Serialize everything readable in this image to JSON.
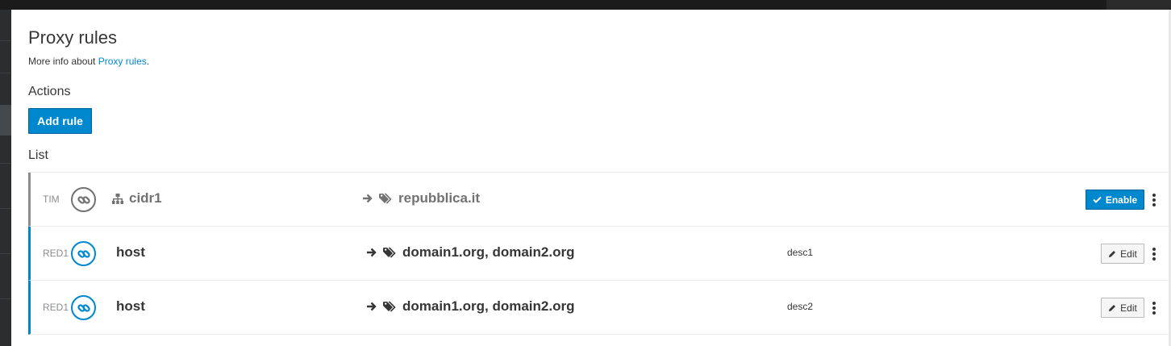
{
  "page": {
    "title": "Proxy rules",
    "more_info_prefix": "More info about",
    "more_info_link": "Proxy rules",
    "more_info_suffix": ".",
    "actions_heading": "Actions",
    "add_rule_label": "Add rule",
    "list_heading": "List"
  },
  "rules": [
    {
      "category": "TIM",
      "source": "cidr1",
      "source_icon": "network-icon",
      "destination": "repubblica.it",
      "description": "",
      "action_label": "Enable",
      "enabled": false
    },
    {
      "category": "RED1",
      "source": "host",
      "source_icon": "",
      "destination": "domain1.org, domain2.org",
      "description": "desc1",
      "action_label": "Edit",
      "enabled": true
    },
    {
      "category": "RED1",
      "source": "host",
      "source_icon": "",
      "destination": "domain1.org, domain2.org",
      "description": "desc2",
      "action_label": "Edit",
      "enabled": true
    }
  ],
  "colors": {
    "accent": "#0088ce",
    "disabled": "#8b8d8f",
    "text": "#363636"
  }
}
